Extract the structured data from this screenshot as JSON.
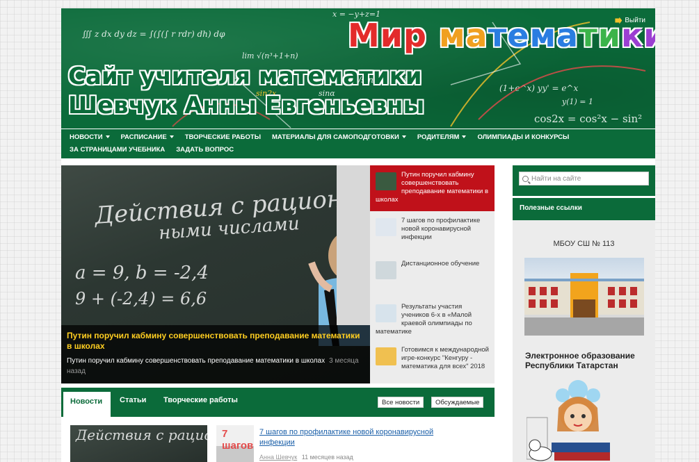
{
  "header": {
    "brand": [
      "Мир ",
      "ма",
      "тема",
      "ти",
      "ки"
    ],
    "subtitle_line1": "Сайт учителя математики",
    "subtitle_line2": "Шевчук Анны Евгеньевны",
    "exit_label": "Выйти",
    "formula_1": "∭ z dx dy dz = ∫(∫(∫ r rdr) dh) dφ",
    "formula_2": "lim √(n³+1+n)",
    "formula_3": "a/sinB = c/sinγ",
    "formula_4": "(1+e^x) yy' = e^x",
    "formula_5": "y(1) = 1",
    "formula_6": "cos2x = cos²x − sin²",
    "formula_7": "x = −y+z=1",
    "formula_8": "sin2x",
    "formula_9": "sinα"
  },
  "nav": {
    "items": [
      {
        "label": "НОВОСТИ",
        "dropdown": true
      },
      {
        "label": "РАСПИСАНИЕ",
        "dropdown": true
      },
      {
        "label": "ТВОРЧЕСКИЕ РАБОТЫ",
        "dropdown": false
      },
      {
        "label": "МАТЕРИАЛЫ ДЛЯ САМОПОДГОТОВКИ",
        "dropdown": true
      },
      {
        "label": "РОДИТЕЛЯМ",
        "dropdown": true
      },
      {
        "label": "ОЛИМПИАДЫ И КОНКУРСЫ",
        "dropdown": false
      },
      {
        "label": "ЗА СТРАНИЦАМИ УЧЕБНИКА",
        "dropdown": false
      },
      {
        "label": "ЗАДАТЬ ВОПРОС",
        "dropdown": false
      }
    ]
  },
  "feature": {
    "board_line1": "Действия с рациональ-",
    "board_line2": "ными числами",
    "board_line3": "a = 9, b = -2,4",
    "board_line4": "9 + (-2,4) = 6,6",
    "title": "Путин поручил кабмину совершенствовать преподавание математики в школах",
    "subtitle": "Путин поручил кабмину совершенствовать преподавание математики в школах",
    "age": "3 месяца назад"
  },
  "side_news": [
    {
      "title": "Путин поручил кабмину совершенствовать преподавание математики в школах",
      "active": true
    },
    {
      "title": "7 шагов по профилактике новой коронавирусной инфекции",
      "active": false
    },
    {
      "title": "Дистанционное обучение",
      "active": false
    },
    {
      "title": "Результаты участия учеников 6-х в «Малой краевой олимпиады по математике",
      "active": false
    },
    {
      "title": "Готовимся к международной игре-конкурс \"Кенгуру - математика для всех\" 2018",
      "active": false
    }
  ],
  "sidebar": {
    "search_placeholder": "Найти на сайте",
    "links_title": "Полезные ссылки",
    "school_name": "МБОУ СШ № 113",
    "edu_title": "Электронное образование Республики Татарстан"
  },
  "tabs": {
    "items": [
      "Новости",
      "Статьи",
      "Творческие работы"
    ],
    "btn_all": "Все новости",
    "btn_discussed": "Обсуждаемые"
  },
  "bottom_news": {
    "title": "7 шагов по профилактике новой коронавирусной инфекции",
    "author": "Анна Шевчук",
    "age": "11 месяцев назад",
    "thumb_label": "7 шагов"
  },
  "colors": {
    "green": "#0b6b3a",
    "red": "#c0111a",
    "feature_title": "#ffce21"
  }
}
